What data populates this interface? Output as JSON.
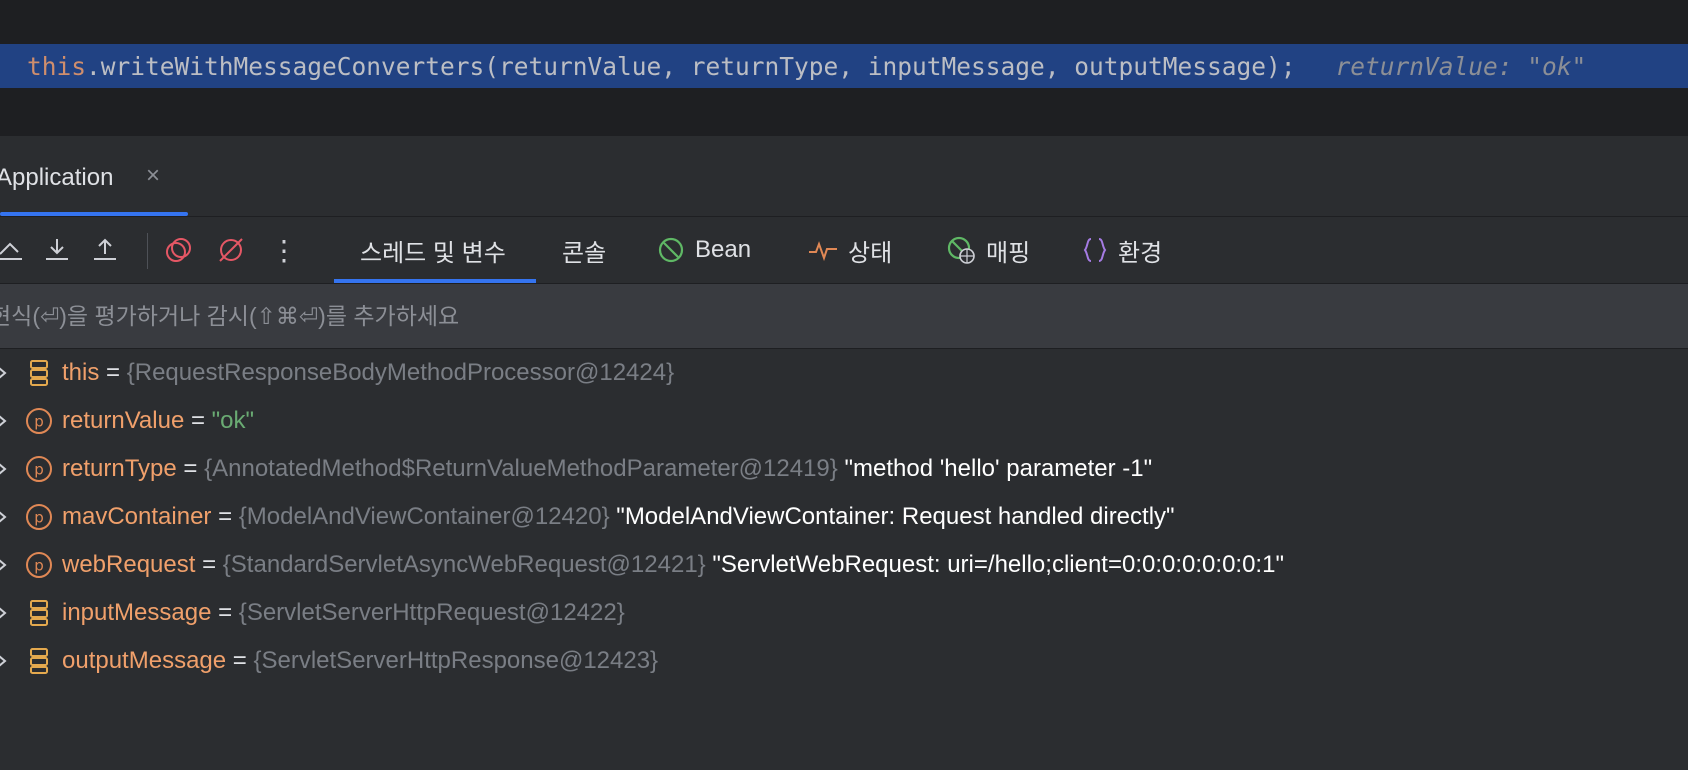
{
  "editor": {
    "keyword": "this",
    "code": ".writeWithMessageConverters(returnValue, returnType, inputMessage, outputMessage);",
    "inline_value": "returnValue: \"ok\""
  },
  "run_tab": {
    "label": "Application",
    "close": "×"
  },
  "toolbar": {
    "more": "⋮"
  },
  "view_tabs": [
    {
      "label": "스레드 및 변수",
      "active": true
    },
    {
      "label": "콘솔"
    },
    {
      "label": "Bean",
      "icon": "bean-icon"
    },
    {
      "label": "상태",
      "icon": "pulse-icon"
    },
    {
      "label": "매핑",
      "icon": "mapping-icon"
    },
    {
      "label": "환경",
      "icon": "braces-icon"
    }
  ],
  "evaluate": {
    "placeholder": "현식(⏎)을 평가하거나 감시(⇧⌘⏎)를 추가하세요"
  },
  "variables": [
    {
      "icon": "field-icon",
      "name": "this",
      "eq": " = ",
      "type": "{RequestResponseBodyMethodProcessor@12424}",
      "value": ""
    },
    {
      "icon": "parameter-icon",
      "name": "returnValue",
      "eq": " = ",
      "type": "",
      "string_value": "\"ok\""
    },
    {
      "icon": "parameter-icon",
      "name": "returnType",
      "eq": " = ",
      "type": "{AnnotatedMethod$ReturnValueMethodParameter@12419}",
      "value": " \"method 'hello' parameter -1\""
    },
    {
      "icon": "parameter-icon",
      "name": "mavContainer",
      "eq": " = ",
      "type": "{ModelAndViewContainer@12420}",
      "value": " \"ModelAndViewContainer: Request handled directly\""
    },
    {
      "icon": "parameter-icon",
      "name": "webRequest",
      "eq": " = ",
      "type": "{StandardServletAsyncWebRequest@12421}",
      "value": " \"ServletWebRequest: uri=/hello;client=0:0:0:0:0:0:0:1\""
    },
    {
      "icon": "field-icon",
      "name": "inputMessage",
      "eq": " = ",
      "type": "{ServletServerHttpRequest@12422}",
      "value": ""
    },
    {
      "icon": "field-icon",
      "name": "outputMessage",
      "eq": " = ",
      "type": "{ServletServerHttpResponse@12423}",
      "value": ""
    }
  ],
  "colors": {
    "accent": "#3574f0",
    "variable_name": "#f0a06b",
    "type_text": "#7a7e85",
    "string": "#6aab73",
    "selection_line": "#214283"
  }
}
